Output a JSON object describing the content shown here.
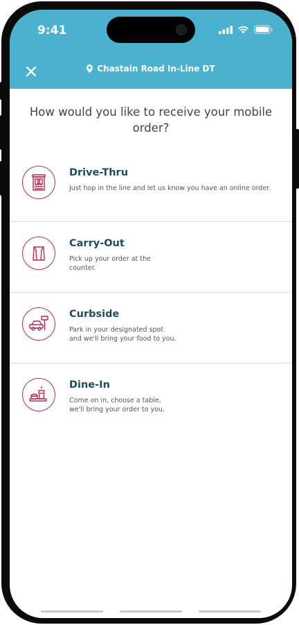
{
  "status_bar": {
    "time": "9:41"
  },
  "header": {
    "close_icon": "close-icon",
    "location_icon": "location-pin-icon",
    "location": "Chastain Road In-Line DT"
  },
  "question": "How would you like to receive your mobile order?",
  "options": [
    {
      "title": "Drive-Thru",
      "description": "Just hop in the line and let us know you have an online order.",
      "icon": "drive-thru-icon"
    },
    {
      "title": "Carry-Out",
      "description": "Pick up your order at the\ncounter.",
      "icon": "bag-icon"
    },
    {
      "title": "Curbside",
      "description": "Park in your designated spot\nand we'll bring your food to you.",
      "icon": "car-icon"
    },
    {
      "title": "Dine-In",
      "description": "Come on in, choose a table,\nwe'll bring your order to you.",
      "icon": "tray-icon"
    }
  ],
  "colors": {
    "header": "#4ab1cf",
    "accent": "#b72a4b",
    "title": "#1f4d5e"
  }
}
